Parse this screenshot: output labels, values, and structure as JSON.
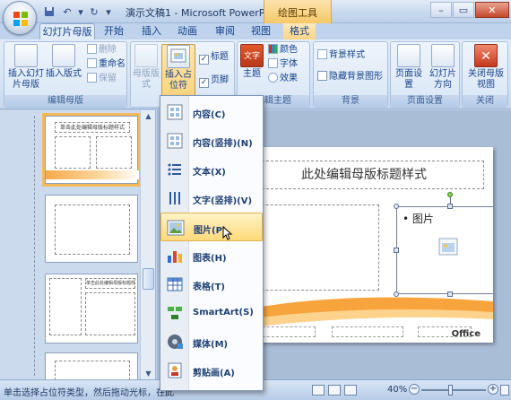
{
  "window": {
    "title": "演示文稿1 - Microsoft PowerPoi...",
    "context_title": "绘图工具"
  },
  "tabs": [
    {
      "label": "幻灯片母版"
    },
    {
      "label": "开始"
    },
    {
      "label": "插入"
    },
    {
      "label": "动画"
    },
    {
      "label": "审阅"
    },
    {
      "label": "视图"
    },
    {
      "label": "格式"
    }
  ],
  "ribbon": {
    "edit_master": {
      "label": "编辑母版",
      "insert_master": "插入幻灯片母版",
      "insert_layout": "插入版式",
      "delete": "删除",
      "rename": "重命名",
      "preserve": "保留"
    },
    "master_layout": {
      "master_layout": "母版版式",
      "insert_placeholder": "插入占位符",
      "title": "标题",
      "footer": "页脚"
    },
    "edit_theme": {
      "label": "编辑主题",
      "themes": "主题",
      "theme_swatch": "文字",
      "colors": "颜色",
      "fonts": "字体",
      "effects": "效果"
    },
    "background": {
      "label": "背景",
      "bg_styles": "背景样式",
      "hide_bg": "隐藏背景图形"
    },
    "page_setup": {
      "label": "页面设置",
      "page_setup": "页面设置",
      "orientation": "幻灯片方向"
    },
    "close": {
      "label": "关闭",
      "close_master": "关闭母版视图"
    }
  },
  "dropdown": {
    "items": [
      {
        "label": "内容(C)"
      },
      {
        "label": "内容(竖排)(N)"
      },
      {
        "label": "文本(X)"
      },
      {
        "label": "文字(竖排)(V)"
      },
      {
        "label": "图片(P)"
      },
      {
        "label": "图表(H)"
      },
      {
        "label": "表格(T)"
      },
      {
        "label": "SmartArt(S)"
      },
      {
        "label": "媒体(M)"
      },
      {
        "label": "剪贴画(A)"
      }
    ]
  },
  "thumbnails": {
    "thumb1_title": "单击此处编辑母版标题样式",
    "thumb3_title": "单击此处编辑母版标题样式"
  },
  "slide": {
    "title": "此处编辑母版标题样式",
    "picture_bullet": "• 图片",
    "office_logo": "Office"
  },
  "statusbar": {
    "message": "单击选择占位符类型，然后拖动光标，在此",
    "zoom": "40%"
  },
  "colors": {
    "ribbon_bg": "#d5e3f4",
    "accent_orange": "#f6b958",
    "hover_yellow": "#ffd97a",
    "close_red": "#c4492c"
  }
}
